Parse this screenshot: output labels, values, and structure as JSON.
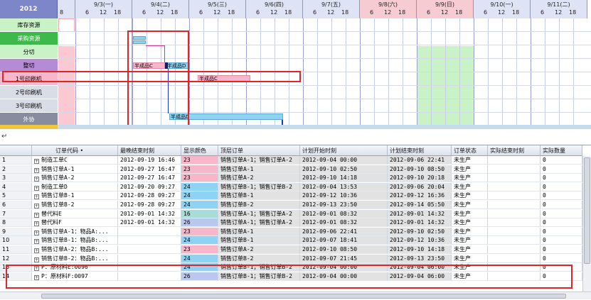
{
  "gantt": {
    "year": "2012",
    "first_col_label": "8",
    "days": [
      {
        "label": "9/3(一)",
        "hours": [
          "6",
          "12",
          "18"
        ],
        "weekend": false
      },
      {
        "label": "9/4(二)",
        "hours": [
          "6",
          "12",
          "18"
        ],
        "weekend": false
      },
      {
        "label": "9/5(三)",
        "hours": [
          "6",
          "12",
          "18"
        ],
        "weekend": false
      },
      {
        "label": "9/6(四)",
        "hours": [
          "6",
          "12",
          "18"
        ],
        "weekend": false
      },
      {
        "label": "9/7(五)",
        "hours": [
          "6",
          "12",
          "18"
        ],
        "weekend": false
      },
      {
        "label": "9/8(六)",
        "hours": [
          "6",
          "12",
          "18"
        ],
        "weekend": true
      },
      {
        "label": "9/9(日)",
        "hours": [
          "6",
          "12",
          "18"
        ],
        "weekend": true
      },
      {
        "label": "9/10(一)",
        "hours": [
          "6",
          "12",
          "18"
        ],
        "weekend": false
      },
      {
        "label": "9/11(二)",
        "hours": [
          "6",
          "12",
          "18"
        ],
        "weekend": false
      }
    ],
    "resources": [
      {
        "label": "库存资源",
        "color": "#c9f2c7"
      },
      {
        "label": "采购资源",
        "color": "#3db84a"
      },
      {
        "label": "分切",
        "color": "#c9f2c7"
      },
      {
        "label": "整切",
        "color": "#b58bd3"
      },
      {
        "label": "1号印刷机",
        "color": "#f7b6c9"
      },
      {
        "label": "2号印刷机",
        "color": "#d9dde6"
      },
      {
        "label": "3号印刷机",
        "color": "#d9dde6"
      },
      {
        "label": "外协",
        "color": "#878c9e"
      }
    ],
    "bars": [
      {
        "row": 3,
        "label": "半成品C",
        "kind": "pink"
      },
      {
        "row": 3,
        "label": "半成品D",
        "kind": "blue"
      },
      {
        "row": 4,
        "label": "半成品C",
        "kind": "pink"
      },
      {
        "row": 7,
        "label": "半成品D",
        "kind": "blue"
      }
    ]
  },
  "separator_glyph": "↵",
  "table": {
    "columns": [
      "",
      "订单代码",
      "最晚结束时刻",
      "显示颜色",
      "顶层订单",
      "计划开始时刻",
      "计划结束时刻",
      "订单状态",
      "实际结束时刻",
      "实际数量"
    ],
    "sort_marker": "•",
    "rows": [
      {
        "no": "1",
        "code": "制造工单C",
        "late": "2012-09-19 16:46",
        "color_val": "23",
        "color": "#f7b6c9",
        "top": "销售订单A-1；销售订单A-2",
        "start": "2012-09-04 00:00",
        "end": "2012-09-06 22:41",
        "status": "未生产",
        "actual_end": "",
        "qty": "0"
      },
      {
        "no": "2",
        "code": "销售订单A-1",
        "late": "2012-09-27 16:47",
        "color_val": "23",
        "color": "#f7b6c9",
        "top": "销售订单A-1",
        "start": "2012-09-10 02:50",
        "end": "2012-09-10 08:50",
        "status": "未生产",
        "actual_end": "",
        "qty": "0"
      },
      {
        "no": "3",
        "code": "销售订单A-2",
        "late": "2012-09-27 16:47",
        "color_val": "23",
        "color": "#f7b6c9",
        "top": "销售订单A-2",
        "start": "2012-09-10 14:18",
        "end": "2012-09-10 20:18",
        "status": "未生产",
        "actual_end": "",
        "qty": "0"
      },
      {
        "no": "4",
        "code": "制造工单D",
        "late": "2012-09-20 09:27",
        "color_val": "24",
        "color": "#8fd3f4",
        "top": "销售订单B-1；销售订单B-2",
        "start": "2012-09-04 13:53",
        "end": "2012-09-06 20:04",
        "status": "未生产",
        "actual_end": "",
        "qty": "0"
      },
      {
        "no": "5",
        "code": "销售订单B-1",
        "late": "2012-09-28 09:27",
        "color_val": "24",
        "color": "#8fd3f4",
        "top": "销售订单B-1",
        "start": "2012-09-12 10:36",
        "end": "2012-09-12 16:36",
        "status": "未生产",
        "actual_end": "",
        "qty": "0"
      },
      {
        "no": "6",
        "code": "销售订单B-2",
        "late": "2012-09-28 09:27",
        "color_val": "24",
        "color": "#8fd3f4",
        "top": "销售订单B-2",
        "start": "2012-09-13 23:50",
        "end": "2012-09-14 05:50",
        "status": "未生产",
        "actual_end": "",
        "qty": "0"
      },
      {
        "no": "7",
        "code": "替代料E",
        "late": "2012-09-01 14:32",
        "color_val": "16",
        "color": "#a9dcd8",
        "top": "销售订单A-1；销售订单A-2",
        "start": "2012-09-01 08:32",
        "end": "2012-09-01 14:32",
        "status": "未生产",
        "actual_end": "",
        "qty": "0"
      },
      {
        "no": "8",
        "code": "替代料F",
        "late": "2012-09-01 14:32",
        "color_val": "26",
        "color": "#b9c8ee",
        "top": "销售订单A-1；销售订单A-2",
        "start": "2012-09-01 08:32",
        "end": "2012-09-01 14:32",
        "status": "未生产",
        "actual_end": "",
        "qty": "0"
      },
      {
        "no": "9",
        "code": "销售订单A-1：物品A:...",
        "late": "",
        "color_val": "23",
        "color": "#f7b6c9",
        "top": "销售订单A-1",
        "start": "2012-09-06 22:41",
        "end": "2012-09-10 02:50",
        "status": "未生产",
        "actual_end": "",
        "qty": "0"
      },
      {
        "no": "10",
        "code": "销售订单B-1：物品B:...",
        "late": "",
        "color_val": "24",
        "color": "#8fd3f4",
        "top": "销售订单B-1",
        "start": "2012-09-07 18:41",
        "end": "2012-09-12 10:36",
        "status": "未生产",
        "actual_end": "",
        "qty": "0"
      },
      {
        "no": "11",
        "code": "销售订单A-2：物品B:...",
        "late": "",
        "color_val": "23",
        "color": "#f7b6c9",
        "top": "销售订单A-2",
        "start": "2012-09-10 08:50",
        "end": "2012-09-10 14:18",
        "status": "未生产",
        "actual_end": "",
        "qty": "0"
      },
      {
        "no": "12",
        "code": "销售订单B-2：物品B:...",
        "late": "",
        "color_val": "24",
        "color": "#8fd3f4",
        "top": "销售订单B-2",
        "start": "2012-09-07 21:45",
        "end": "2012-09-13 23:50",
        "status": "未生产",
        "actual_end": "",
        "qty": "0"
      },
      {
        "no": "13",
        "code": "P：原材料E:0096",
        "late": "",
        "color_val": "24",
        "color": "#8fd3f4",
        "top": "销售订单B-1；销售订单B-2",
        "start": "2012-09-04 00:00",
        "end": "2012-09-04 06:00",
        "status": "未生产",
        "actual_end": "",
        "qty": "0"
      },
      {
        "no": "14",
        "code": "P：原材料F:0097",
        "late": "",
        "color_val": "26",
        "color": "#b9c8ee",
        "top": "销售订单B-1；销售订单B-2",
        "start": "2012-09-04 00:00",
        "end": "2012-09-04 06:00",
        "status": "未生产",
        "actual_end": "",
        "qty": "0"
      }
    ]
  }
}
